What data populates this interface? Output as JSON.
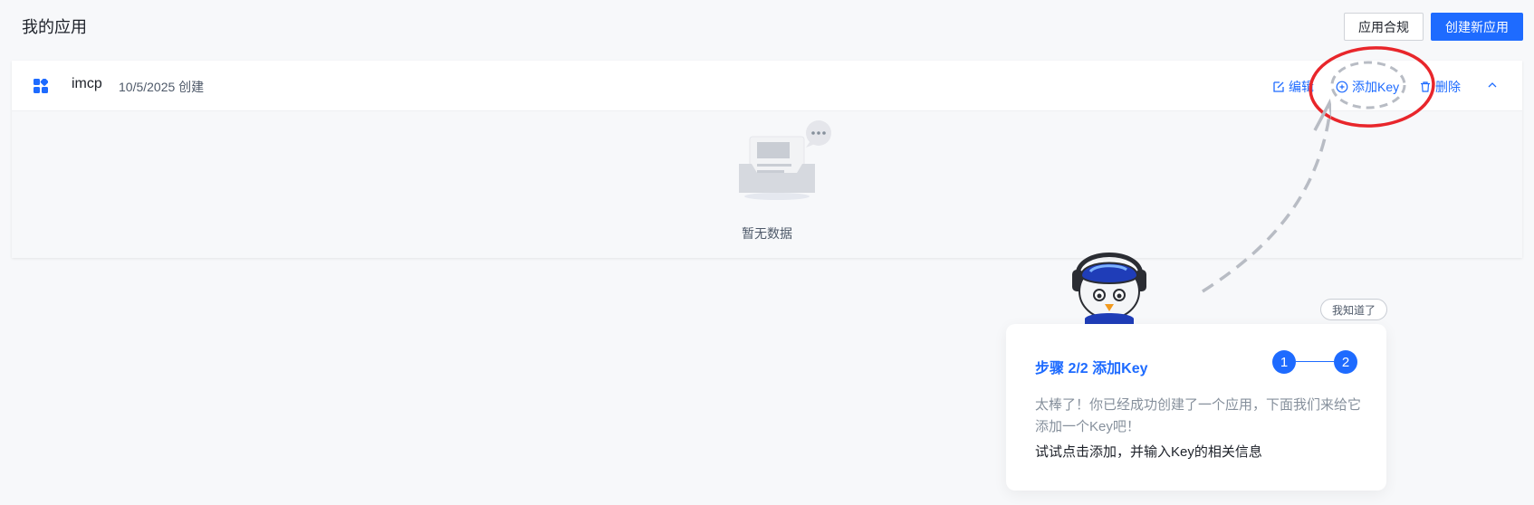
{
  "page": {
    "title": "我的应用"
  },
  "header_buttons": {
    "compliance": "应用合规",
    "create": "创建新应用"
  },
  "app": {
    "name": "imcp",
    "created": "10/5/2025 创建",
    "actions": {
      "edit": "编辑",
      "add_key": "添加Key",
      "delete": "删除"
    },
    "empty_text": "暂无数据"
  },
  "guide": {
    "got_it": "我知道了",
    "title": "步骤 2/2 添加Key",
    "steps": [
      "1",
      "2"
    ],
    "description": "太棒了！你已经成功创建了一个应用，下面我们来给它添加一个Key吧！",
    "hint": "试试点击添加，并输入Key的相关信息"
  },
  "colors": {
    "accent": "#1e6bff",
    "annotation_red": "#e8262b",
    "background": "#f7f8fa"
  },
  "icons": [
    "grid-app-icon",
    "edit-icon",
    "plus-circle-icon",
    "trash-icon",
    "chevron-up-icon",
    "empty-inbox-icon",
    "mascot-icon"
  ]
}
